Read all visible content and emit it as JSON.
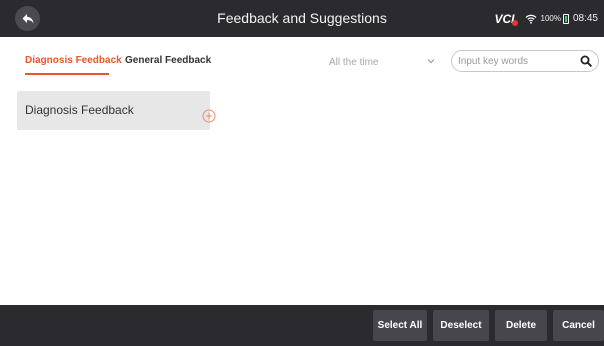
{
  "header": {
    "title": "Feedback and Suggestions",
    "vci_label": "VCI",
    "battery_percent": "100%",
    "time": "08:45"
  },
  "tabs": [
    {
      "label": "Diagnosis Feedback",
      "active": true
    },
    {
      "label": "General Feedback",
      "active": false
    }
  ],
  "filter": {
    "time_range": "All the time",
    "search_placeholder": "Input key words"
  },
  "list": {
    "items": [
      {
        "label": "Diagnosis Feedback"
      }
    ]
  },
  "footer": {
    "select_all": "Select All",
    "deselect": "Deselect",
    "delete": "Delete",
    "cancel": "Cancel"
  },
  "colors": {
    "accent": "#e8572a",
    "bar_bg": "#2b2b2f",
    "button_bg": "#46464c",
    "card_bg": "#e7e7e7"
  },
  "icons": [
    "back-arrow-icon",
    "wifi-icon",
    "battery-icon",
    "chevron-down-icon",
    "search-icon",
    "add-circle-icon"
  ]
}
